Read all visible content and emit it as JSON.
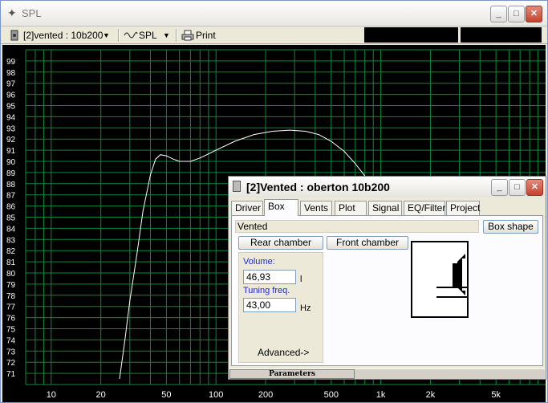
{
  "window": {
    "title": "SPL",
    "buttons": {
      "minimize": "_",
      "maximize": "□",
      "close": "✕"
    }
  },
  "toolbar": {
    "project_label": "[2]vented : 10b200",
    "mode_label": "SPL",
    "print_label": "Print"
  },
  "chart_data": {
    "type": "line",
    "title": "",
    "xlabel": "",
    "ylabel": "",
    "x_scale": "log",
    "xlim": [
      7,
      10000
    ],
    "ylim": [
      70,
      100
    ],
    "grid": true,
    "background": "#000000",
    "grid_color": "#0a8a3a",
    "line_color": "#ffffff",
    "y_ticks": [
      71,
      72,
      73,
      74,
      75,
      76,
      77,
      78,
      79,
      80,
      81,
      82,
      83,
      84,
      85,
      86,
      87,
      88,
      89,
      90,
      91,
      92,
      93,
      94,
      95,
      96,
      97,
      98,
      99
    ],
    "x_ticks": [
      {
        "v": 10,
        "label": "10"
      },
      {
        "v": 20,
        "label": "20"
      },
      {
        "v": 50,
        "label": "50"
      },
      {
        "v": 100,
        "label": "100"
      },
      {
        "v": 200,
        "label": "200"
      },
      {
        "v": 500,
        "label": "500"
      },
      {
        "v": 1000,
        "label": "1k"
      },
      {
        "v": 2000,
        "label": "2k"
      },
      {
        "v": 5000,
        "label": "5k"
      }
    ],
    "series": [
      {
        "x": [
          26,
          28,
          30,
          33,
          36,
          40,
          43,
          46,
          50,
          55,
          60,
          70,
          80,
          100,
          130,
          170,
          220,
          280,
          350,
          420,
          500,
          600,
          700,
          800
        ],
        "values": [
          70.5,
          74,
          77.5,
          81.5,
          85.5,
          88.8,
          90.2,
          90.6,
          90.5,
          90.2,
          90.0,
          90.0,
          90.3,
          91.0,
          91.8,
          92.4,
          92.7,
          92.8,
          92.7,
          92.4,
          91.8,
          90.9,
          89.8,
          88.7
        ]
      }
    ]
  },
  "dialog": {
    "title": "[2]Vented : oberton 10b200",
    "tabs": [
      "Driver",
      "Box",
      "Vents",
      "Plot",
      "Signal",
      "EQ/Filter",
      "Project"
    ],
    "active_tab": "Box",
    "box_type": "Vented",
    "box_shape_button": "Box shape",
    "rear_chamber_button": "Rear chamber",
    "front_chamber_button": "Front chamber",
    "volume_label": "Volume:",
    "volume_value": "46,93",
    "volume_unit": "l",
    "tuning_label": "Tuning freq.",
    "tuning_value": "43,00",
    "tuning_unit": "Hz",
    "advanced_button": "Advanced->",
    "status_tab": "Parameters"
  }
}
